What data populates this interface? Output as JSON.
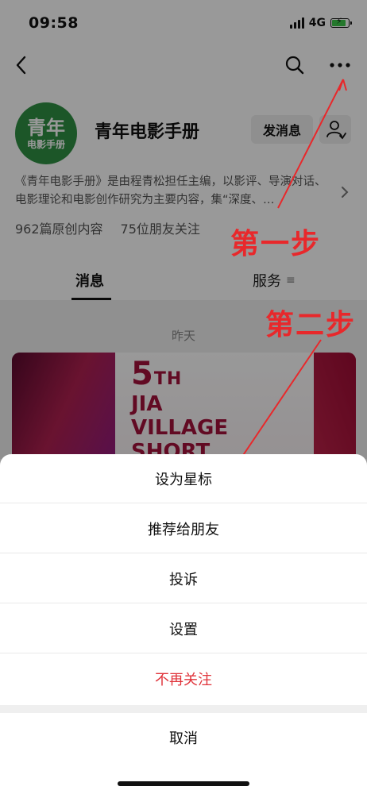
{
  "status_bar": {
    "time": "09:58",
    "network": "4G",
    "battery_color": "#3cc84a",
    "battery_level": 0.75
  },
  "topbar": {
    "back_icon": "chevron-left-icon",
    "search_icon": "search-icon",
    "more_icon": "more-dots-icon"
  },
  "profile": {
    "avatar_line1": "青年",
    "avatar_line2": "电影手册",
    "name": "青年电影手册",
    "send_message_label": "发消息",
    "contact_icon": "person-contact-icon",
    "description": "《青年电影手册》是由程青松担任主编，以影评、导演对话、电影理论和电影创作研究为主要内容，集“深度、…",
    "original_count": "962篇原创内容",
    "friends_follow": "75位朋友关注"
  },
  "tabs": {
    "messages": "消息",
    "services": "服务",
    "services_menu_glyph": "≡"
  },
  "feed": {
    "date_label": "昨天",
    "cover_line1": "5",
    "cover_line1_sup": "TH",
    "cover_line2": "JIA",
    "cover_line3": "VILLAGE",
    "cover_line4": "SHORT"
  },
  "annotations": {
    "step1": "第一步",
    "step2": "第二步",
    "color": "#e8282b"
  },
  "action_sheet": {
    "items": [
      {
        "label": "设为星标"
      },
      {
        "label": "推荐给朋友"
      },
      {
        "label": "投诉"
      },
      {
        "label": "设置"
      },
      {
        "label": "不再关注",
        "danger": true
      }
    ],
    "cancel": "取消",
    "danger_color": "#e0333a"
  }
}
